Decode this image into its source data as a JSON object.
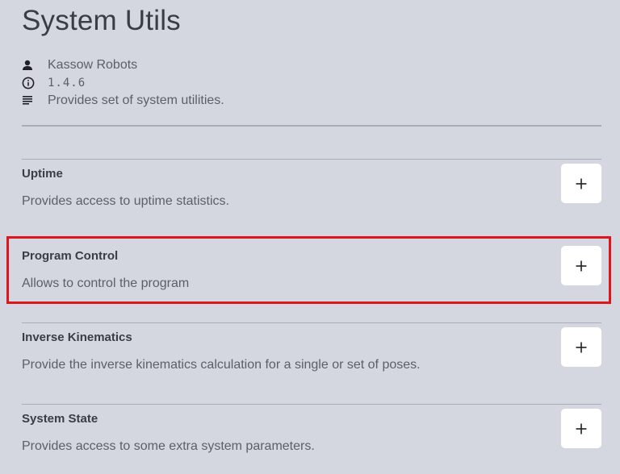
{
  "header": {
    "title": "System Utils",
    "author": "Kassow Robots",
    "version": "1.4.6",
    "description": "Provides set of system utilities."
  },
  "icons": {
    "author": "person-icon",
    "version": "info-icon",
    "description": "text-lines-icon",
    "add": "plus-icon"
  },
  "colors": {
    "background": "#d4d7df",
    "button": "#ffffff",
    "highlight": "#e0141b",
    "divider": "#a9adb5"
  },
  "modules": [
    {
      "name": "Uptime",
      "description": "Provides access to uptime statistics.",
      "button_label": "+",
      "highlighted": false
    },
    {
      "name": "Program Control",
      "description": "Allows to control the program",
      "button_label": "+",
      "highlighted": true
    },
    {
      "name": "Inverse Kinematics",
      "description": "Provide the inverse kinematics calculation for a single or set of poses.",
      "button_label": "+",
      "highlighted": false
    },
    {
      "name": "System State",
      "description": "Provides access to some extra system parameters.",
      "button_label": "+",
      "highlighted": false
    }
  ]
}
